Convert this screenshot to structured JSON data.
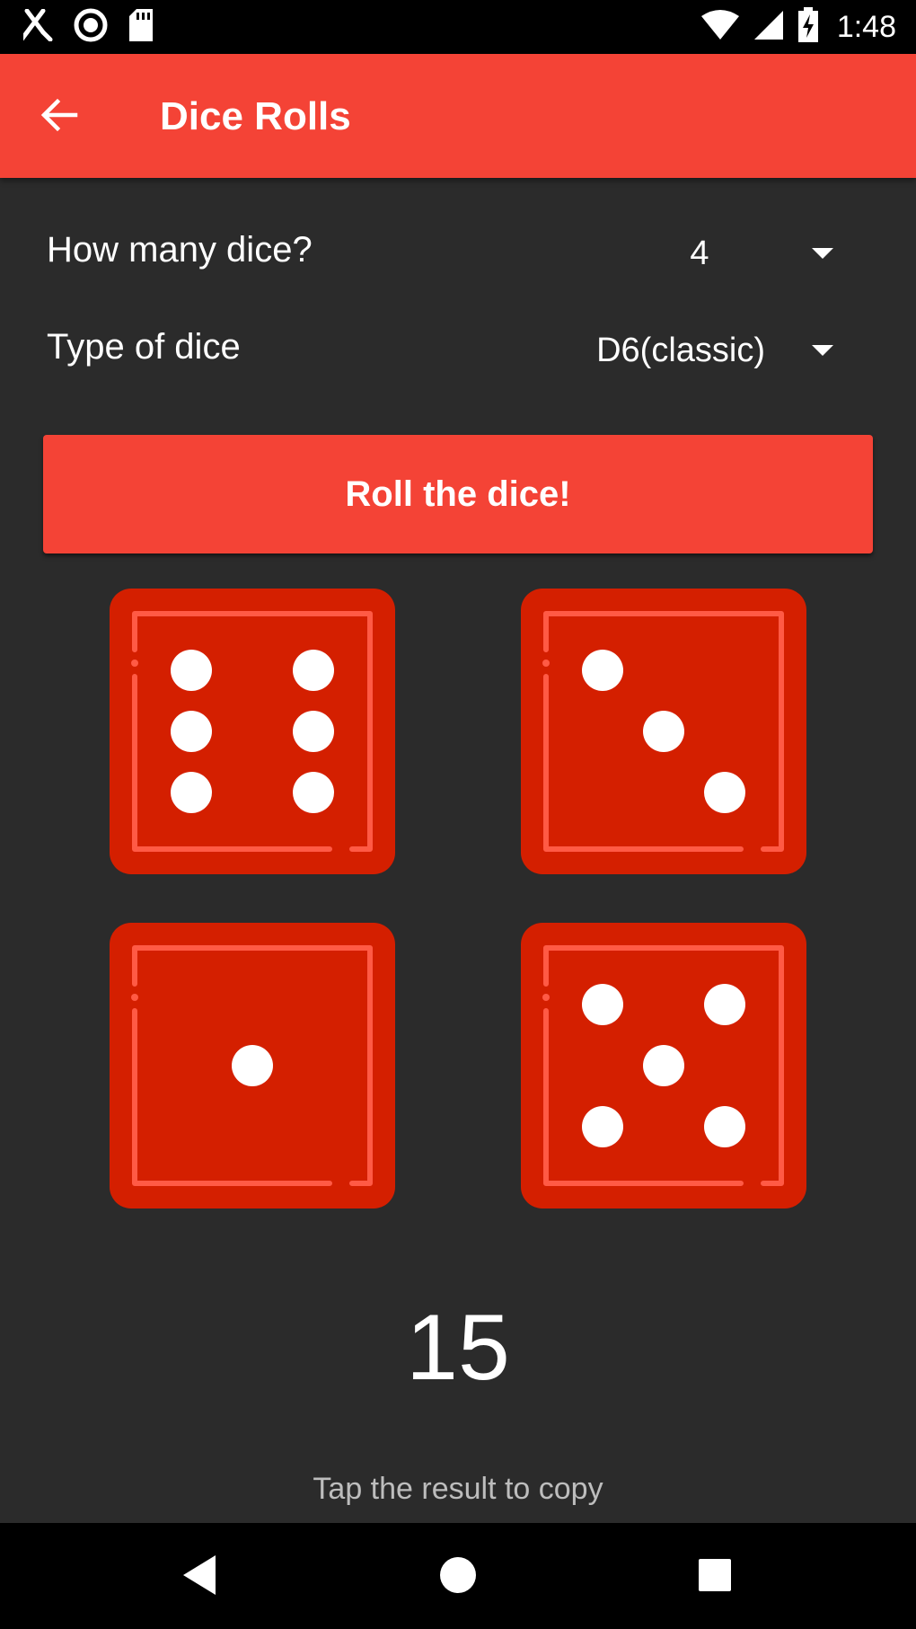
{
  "status_bar": {
    "time": "1:48",
    "left_icons": [
      "restaurant-icon",
      "record-icon",
      "sd-card-icon"
    ],
    "right_icons": [
      "wifi-icon",
      "signal-icon",
      "battery-charging-icon"
    ]
  },
  "app_bar": {
    "title": "Dice Rolls",
    "back_icon": "arrow-back-icon"
  },
  "settings": {
    "dice_count": {
      "label": "How many dice?",
      "value": "4"
    },
    "dice_type": {
      "label": "Type of dice",
      "value": "D6(classic)"
    }
  },
  "roll_button": {
    "label": "Roll the dice!"
  },
  "dice": [
    {
      "value": 6
    },
    {
      "value": 3
    },
    {
      "value": 1
    },
    {
      "value": 5
    }
  ],
  "result": {
    "total": "15",
    "hint": "Tap the result to copy"
  },
  "colors": {
    "primary": "#f44336",
    "die_face": "#d41f00",
    "die_highlight": "#ff5a45",
    "background": "#2b2b2b"
  }
}
